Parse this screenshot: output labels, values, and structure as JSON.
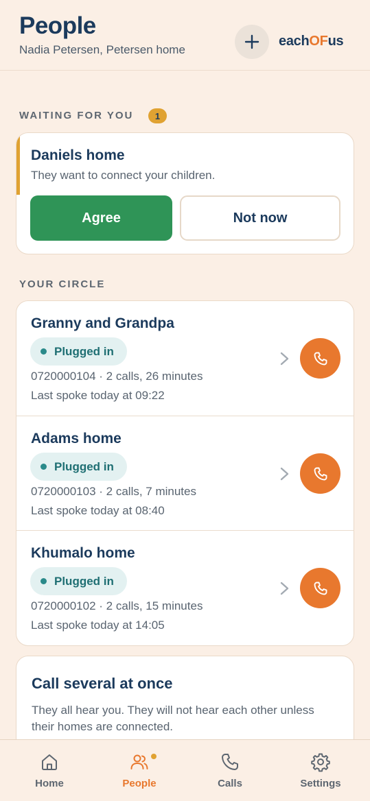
{
  "header": {
    "title": "People",
    "subtitle": "Nadia Petersen, Petersen home",
    "add_icon": "plus-icon",
    "logo": {
      "part1": "each",
      "part2": "OF",
      "part3": "us"
    }
  },
  "waiting": {
    "label": "WAITING FOR YOU",
    "count": "1",
    "request": {
      "name": "Daniels home",
      "description": "They want to connect your children.",
      "agree_label": "Agree",
      "not_now_label": "Not now"
    }
  },
  "circle": {
    "label": "YOUR CIRCLE",
    "contacts": [
      {
        "name": "Granny and Grandpa",
        "status": "Plugged in",
        "details": "0720000104 · 2 calls, 26 minutes",
        "last_spoke": "Last spoke today at 09:22"
      },
      {
        "name": "Adams home",
        "status": "Plugged in",
        "details": "0720000103 · 2 calls, 7 minutes",
        "last_spoke": "Last spoke today at 08:40"
      },
      {
        "name": "Khumalo home",
        "status": "Plugged in",
        "details": "0720000102 · 2 calls, 15 minutes",
        "last_spoke": "Last spoke today at 14:05"
      }
    ]
  },
  "several": {
    "title": "Call several at once",
    "description": "They all hear you. They will not hear each other unless their homes are connected."
  },
  "nav": {
    "items": [
      {
        "label": "Home",
        "icon": "home-icon",
        "active": false
      },
      {
        "label": "People",
        "icon": "people-icon",
        "active": true
      },
      {
        "label": "Calls",
        "icon": "phone-icon",
        "active": false
      },
      {
        "label": "Settings",
        "icon": "gear-icon",
        "active": false
      }
    ]
  },
  "colors": {
    "background": "#fbefe5",
    "primary_text": "#1b3a5c",
    "accent_orange": "#e8782e",
    "agree_green": "#2f9457",
    "badge_amber": "#e0a232",
    "status_teal": "#1f6f73"
  }
}
